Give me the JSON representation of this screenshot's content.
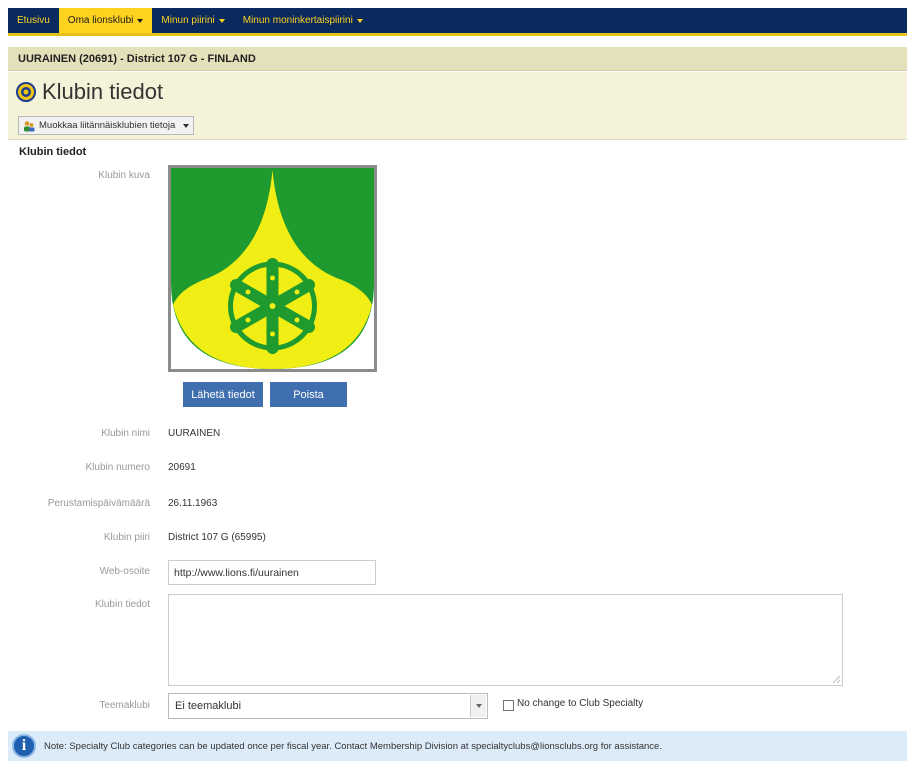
{
  "nav": {
    "items": [
      {
        "label": "Etusivu",
        "active": false,
        "dropdown": false
      },
      {
        "label": "Oma lionsklubi",
        "active": true,
        "dropdown": true
      },
      {
        "label": "Minun piirini",
        "active": false,
        "dropdown": true
      },
      {
        "label": "Minun moninkertaispiirini",
        "active": false,
        "dropdown": true
      }
    ]
  },
  "club_header": "UURAINEN (20691) - District 107 G - FINLAND",
  "page_title": "Klubin tiedot",
  "toolbar": {
    "edit_affiliates_label": "Muokkaa liitännäisklubien tietoja"
  },
  "section_title": "Klubin tiedot",
  "form": {
    "image_label": "Klubin kuva",
    "send_button": "Lähetä tiedot",
    "delete_button": "Poista",
    "name_label": "Klubin nimi",
    "name_value": "UURAINEN",
    "number_label": "Klubin numero",
    "number_value": "20691",
    "founded_label": "Perustamispäivämäärä",
    "founded_value": "26.11.1963",
    "district_label": "Klubin piiri",
    "district_value": "District 107 G (65995)",
    "web_label": "Web-osoite",
    "web_value": "http://www.lions.fi/uurainen",
    "info_label": "Klubin tiedot",
    "info_value": "",
    "theme_label": "Teemaklubi",
    "theme_value": "Ei teemaklubi",
    "no_change_label": "No change to Club Specialty",
    "no_change_checked": false
  },
  "note": "Note: Specialty Club categories can be updated once per fiscal year. Contact Membership Division at specialtyclubs@lionsclubs.org for assistance.",
  "colors": {
    "nav_bg": "#0a2a5e",
    "nav_accent": "#ffd21f",
    "crest_green": "#1e9a2e",
    "crest_yellow": "#f0ee14",
    "button_blue": "#3f6fae",
    "note_bg": "#dcebf8"
  }
}
